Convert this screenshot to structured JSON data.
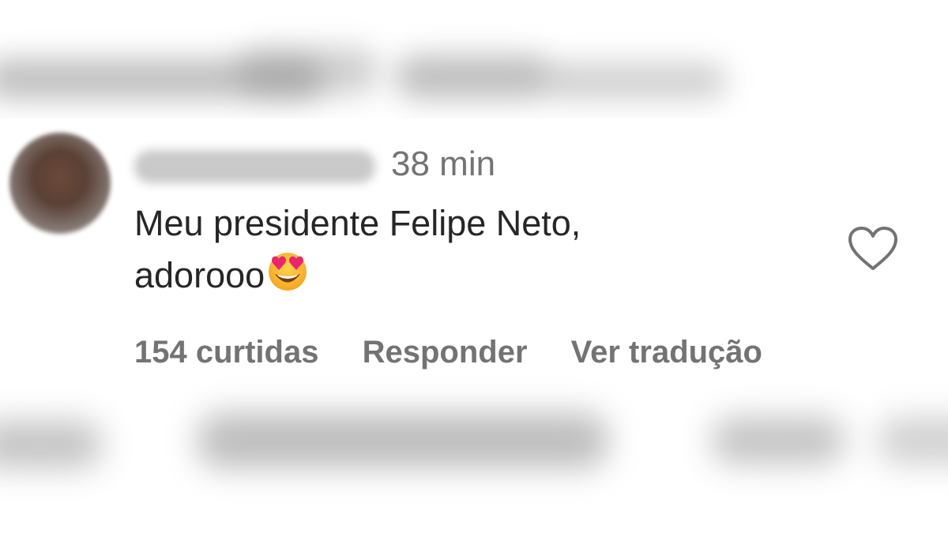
{
  "comment": {
    "timestamp": "38 min",
    "text_line1": "Meu presidente Felipe Neto,",
    "text_line2": "adorooo",
    "emoji": "heart-eyes-emoji"
  },
  "actions": {
    "likes": "154 curtidas",
    "reply": "Responder",
    "translate": "Ver tradução"
  },
  "icons": {
    "like": "heart-outline-icon"
  },
  "colors": {
    "text_primary": "#262626",
    "text_secondary": "#737373",
    "background": "#ffffff"
  }
}
